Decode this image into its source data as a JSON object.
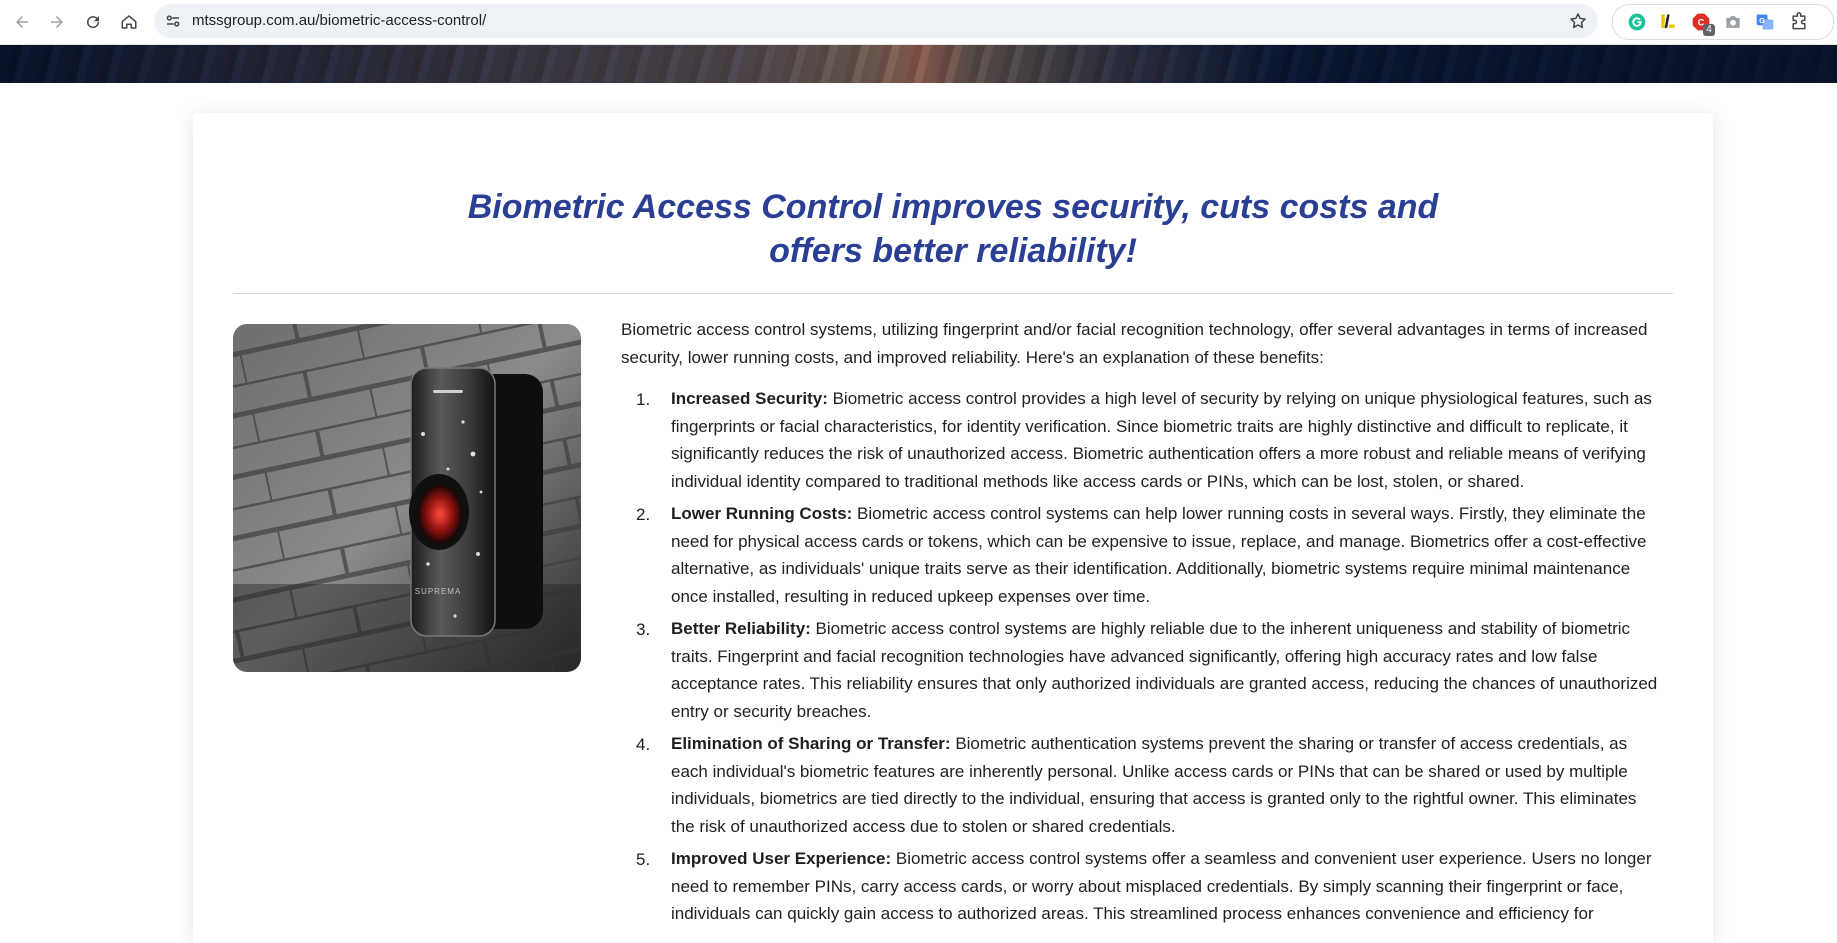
{
  "browser": {
    "url": "mtssgroup.com.au/biometric-access-control/",
    "extension_badge": "4"
  },
  "article": {
    "title_line1": "Biometric Access Control improves security, cuts costs and",
    "title_line2": "offers better reliability!",
    "image_brand_text": "SUPREMA",
    "intro": "Biometric access control systems, utilizing fingerprint and/or facial recognition technology, offer several advantages in terms of increased security, lower running costs, and improved reliability. Here's an explanation of these benefits:",
    "items": [
      {
        "number": "1.",
        "lead": "Increased Security:",
        "text": " Biometric access control provides a high level of security by relying on unique physiological features, such as fingerprints or facial characteristics, for identity verification. Since biometric traits are highly distinctive and difficult to replicate, it significantly reduces the risk of unauthorized access. Biometric authentication offers a more robust and reliable means of verifying individual identity compared to traditional methods like access cards or PINs, which can be lost, stolen, or shared."
      },
      {
        "number": "2.",
        "lead": "Lower Running Costs:",
        "text": " Biometric access control systems can help lower running costs in several ways. Firstly, they eliminate the need for physical access cards or tokens, which can be expensive to issue, replace, and manage. Biometrics offer a cost-effective alternative, as individuals' unique traits serve as their identification. Additionally, biometric systems require minimal maintenance once installed, resulting in reduced upkeep expenses over time."
      },
      {
        "number": "3.",
        "lead": "Better Reliability:",
        "text": " Biometric access control systems are highly reliable due to the inherent uniqueness and stability of biometric traits. Fingerprint and facial recognition technologies have advanced significantly, offering high accuracy rates and low false acceptance rates. This reliability ensures that only authorized individuals are granted access, reducing the chances of unauthorized entry or security breaches."
      },
      {
        "number": "4.",
        "lead": "Elimination of Sharing or Transfer:",
        "text": " Biometric authentication systems prevent the sharing or transfer of access credentials, as each individual's biometric features are inherently personal. Unlike access cards or PINs that can be shared or used by multiple individuals, biometrics are tied directly to the individual, ensuring that access is granted only to the rightful owner. This eliminates the risk of unauthorized access due to stolen or shared credentials."
      },
      {
        "number": "5.",
        "lead": "Improved User Experience:",
        "text": " Biometric access control systems offer a seamless and convenient user experience. Users no longer need to remember PINs, carry access cards, or worry about misplaced credentials. By simply scanning their fingerprint or face, individuals can quickly gain access to authorized areas. This streamlined process enhances convenience and efficiency for"
      }
    ]
  },
  "colors": {
    "title": "#2a3f94",
    "body_text": "#1f1f1f",
    "omnibox_bg": "#eef1f6"
  },
  "icons": [
    "back-arrow-icon",
    "forward-arrow-icon",
    "reload-icon",
    "home-icon",
    "site-info-icon",
    "bookmark-star-icon",
    "grammarly-icon",
    "pen-extension-icon",
    "adblock-icon",
    "camera-icon",
    "translate-icon",
    "puzzle-extensions-icon"
  ]
}
